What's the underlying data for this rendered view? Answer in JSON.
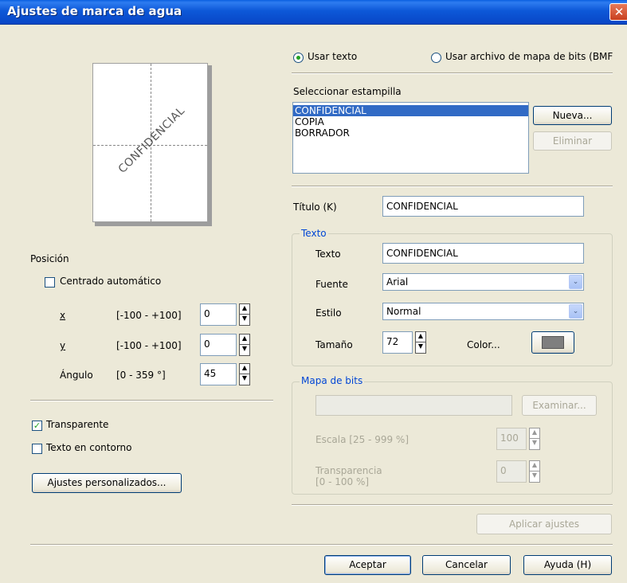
{
  "window": {
    "title": "Ajustes de marca de agua",
    "close_glyph": "✕"
  },
  "preview": {
    "watermark_text": "CONFIDENCIAL"
  },
  "source": {
    "use_text": {
      "label": "Usar texto",
      "selected": true
    },
    "use_bitmap": {
      "label": "Usar archivo de mapa de bits (BMF",
      "selected": false
    }
  },
  "stamp": {
    "label": "Seleccionar estampilla",
    "items": [
      "CONFIDENCIAL",
      "COPIA",
      "BORRADOR"
    ],
    "selected_index": 0,
    "new_button": "Nueva...",
    "delete_button": "Eliminar"
  },
  "title_field": {
    "label": "Título (K)",
    "value": "CONFIDENCIAL"
  },
  "text_group": {
    "legend": "Texto",
    "text_label": "Texto",
    "text_value": "CONFIDENCIAL",
    "font_label": "Fuente",
    "font_value": "Arial",
    "style_label": "Estilo",
    "style_value": "Normal",
    "size_label": "Tamaño",
    "size_value": "72",
    "color_label": "Color...",
    "color_value": "#7f7f7f"
  },
  "bitmap_group": {
    "legend": "Mapa de bits",
    "file_value": "",
    "browse_button": "Examinar...",
    "scale_label": "Escala [25 - 999 %]",
    "scale_value": "100",
    "transparency_label_1": "Transparencia",
    "transparency_label_2": "[0 - 100 %]",
    "transparency_value": "0"
  },
  "apply_button": "Aplicar ajustes",
  "position": {
    "label": "Posición",
    "auto_center": {
      "label": "Centrado automático",
      "checked": false
    },
    "x": {
      "label": "x",
      "range": "[-100 - +100]",
      "value": "0"
    },
    "y": {
      "label": "y",
      "range": "[-100 - +100]",
      "value": "0"
    },
    "angle": {
      "label": "Ángulo",
      "range": "[0 - 359 °]",
      "value": "45"
    }
  },
  "options": {
    "transparent": {
      "label": "Transparente",
      "checked": true
    },
    "outline": {
      "label": "Texto en contorno",
      "checked": false
    },
    "custom_button": "Ajustes personalizados..."
  },
  "footer": {
    "ok": "Aceptar",
    "cancel": "Cancelar",
    "help": "Ayuda (H)"
  },
  "icons": {
    "spin_up": "▲",
    "spin_down": "▼",
    "combo_arrow": "⌄",
    "check": "✓"
  }
}
